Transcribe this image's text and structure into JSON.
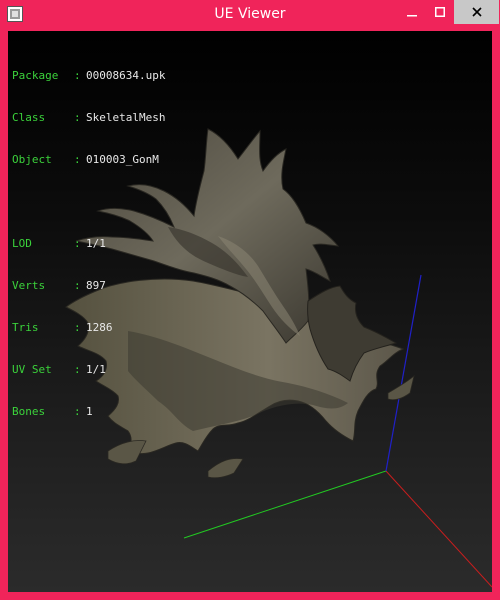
{
  "window": {
    "title": "UE Viewer",
    "icons": {
      "app": "ue-app-icon",
      "minimize": "minimize-icon",
      "maximize": "maximize-icon",
      "close": "close-icon"
    },
    "colors": {
      "frame": "#f0245a",
      "close_bg": "#c8c8c8"
    }
  },
  "info": {
    "package": {
      "label": "Package",
      "value": "00008634.upk"
    },
    "class": {
      "label": "Class",
      "value": "SkeletalMesh"
    },
    "object": {
      "label": "Object",
      "value": "010003_GonM"
    },
    "lod": {
      "label": "LOD",
      "value": "1/1"
    },
    "verts": {
      "label": "Verts",
      "value": "897"
    },
    "tris": {
      "label": "Tris",
      "value": "1286"
    },
    "uvset": {
      "label": "UV Set",
      "value": "1/1"
    },
    "bones": {
      "label": "Bones",
      "value": "1"
    },
    "colors": {
      "label": "#3bd23b",
      "value": "#e8e8e8"
    }
  },
  "axes": {
    "x_color": "#c81e1e",
    "y_color": "#22c822",
    "z_color": "#2020c8"
  }
}
